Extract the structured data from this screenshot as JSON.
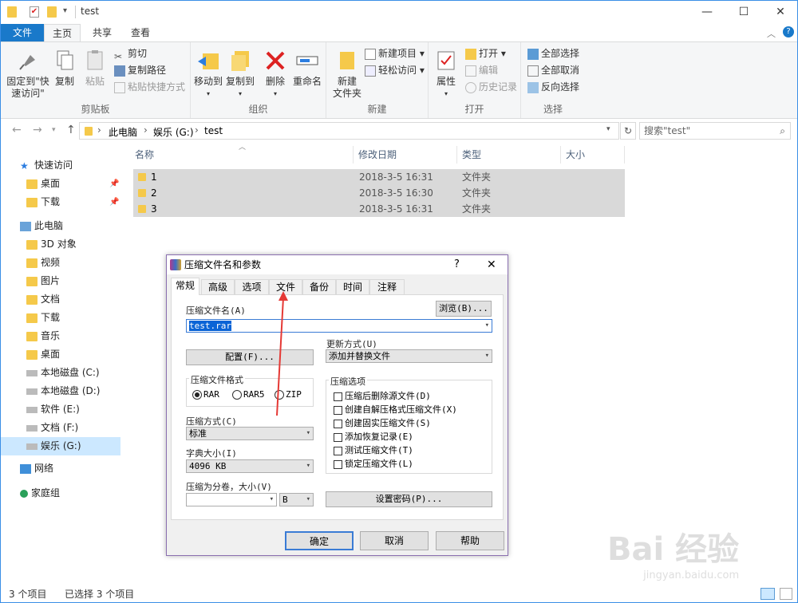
{
  "window": {
    "title": "test",
    "minimize_icon": "minimize-icon",
    "maximize_icon": "maximize-icon",
    "close_icon": "close-icon"
  },
  "ribbon_tabs": [
    "文件",
    "主页",
    "共享",
    "查看"
  ],
  "ribbon": {
    "clipboard": {
      "label": "剪贴板",
      "pin_line1": "固定到\"快",
      "pin_line2": "速访问\"",
      "copy": "复制",
      "paste": "粘贴",
      "cut": "剪切",
      "copy_path": "复制路径",
      "paste_shortcut": "粘贴快捷方式"
    },
    "organize": {
      "label": "组织",
      "move_to": "移动到",
      "copy_to": "复制到",
      "delete": "删除",
      "rename": "重命名"
    },
    "new": {
      "label": "新建",
      "new_folder_line1": "新建",
      "new_folder_line2": "文件夹",
      "new_item": "新建项目",
      "easy_access": "轻松访问"
    },
    "open": {
      "label": "打开",
      "properties": "属性",
      "open": "打开",
      "edit": "编辑",
      "history": "历史记录"
    },
    "select": {
      "label": "选择",
      "select_all": "全部选择",
      "select_none": "全部取消",
      "invert": "反向选择"
    }
  },
  "address": {
    "parts": [
      "此电脑",
      "娱乐 (G:)",
      "test"
    ],
    "search_placeholder": "搜索\"test\""
  },
  "nav": [
    {
      "label": "快速访问",
      "icon": "star-icon"
    },
    {
      "label": "桌面",
      "icon": "desktop-folder-icon"
    },
    {
      "label": "下载",
      "icon": "download-folder-icon"
    },
    {
      "label": "此电脑",
      "icon": "computer-icon"
    },
    {
      "label": "3D 对象",
      "icon": "3d-folder-icon"
    },
    {
      "label": "视频",
      "icon": "video-folder-icon"
    },
    {
      "label": "图片",
      "icon": "pictures-folder-icon"
    },
    {
      "label": "文档",
      "icon": "documents-folder-icon"
    },
    {
      "label": "下载",
      "icon": "download-folder-icon"
    },
    {
      "label": "音乐",
      "icon": "music-folder-icon"
    },
    {
      "label": "桌面",
      "icon": "desktop-folder-icon"
    },
    {
      "label": "本地磁盘 (C:)",
      "icon": "drive-icon"
    },
    {
      "label": "本地磁盘 (D:)",
      "icon": "drive-icon"
    },
    {
      "label": "软件 (E:)",
      "icon": "drive-icon"
    },
    {
      "label": "文档 (F:)",
      "icon": "drive-icon"
    },
    {
      "label": "娱乐 (G:)",
      "icon": "drive-icon"
    },
    {
      "label": "网络",
      "icon": "network-icon"
    },
    {
      "label": "家庭组",
      "icon": "homegroup-icon"
    }
  ],
  "columns": [
    "名称",
    "修改日期",
    "类型",
    "大小"
  ],
  "files": [
    {
      "name": "1",
      "date": "2018-3-5 16:31",
      "type": "文件夹"
    },
    {
      "name": "2",
      "date": "2018-3-5 16:30",
      "type": "文件夹"
    },
    {
      "name": "3",
      "date": "2018-3-5 16:31",
      "type": "文件夹"
    }
  ],
  "status": {
    "count": "3 个项目",
    "selected": "已选择 3 个项目"
  },
  "dialog": {
    "title": "压缩文件名和参数",
    "help": "?",
    "close": "✕",
    "tabs": [
      "常规",
      "高级",
      "选项",
      "文件",
      "备份",
      "时间",
      "注释"
    ],
    "archive_name_label": "压缩文件名(A)",
    "browse": "浏览(B)...",
    "archive_name": "test.rar",
    "update_label": "更新方式(U)",
    "update_value": "添加并替换文件",
    "profiles": "配置(F)...",
    "format_label": "压缩文件格式",
    "formats": [
      "RAR",
      "RAR5",
      "ZIP"
    ],
    "format_selected": "RAR",
    "method_label": "压缩方式(C)",
    "method_value": "标准",
    "dict_label": "字典大小(I)",
    "dict_value": "4096 KB",
    "split_label": "压缩为分卷，大小(V)",
    "split_value": "",
    "split_unit": "B",
    "options_label": "压缩选项",
    "options": [
      "压缩后删除源文件(D)",
      "创建自解压格式压缩文件(X)",
      "创建固实压缩文件(S)",
      "添加恢复记录(E)",
      "测试压缩文件(T)",
      "锁定压缩文件(L)"
    ],
    "password": "设置密码(P)...",
    "ok": "确定",
    "cancel": "取消",
    "helpbtn": "帮助"
  },
  "watermark": "Bai 经验",
  "watermark_url": "jingyan.baidu.com"
}
